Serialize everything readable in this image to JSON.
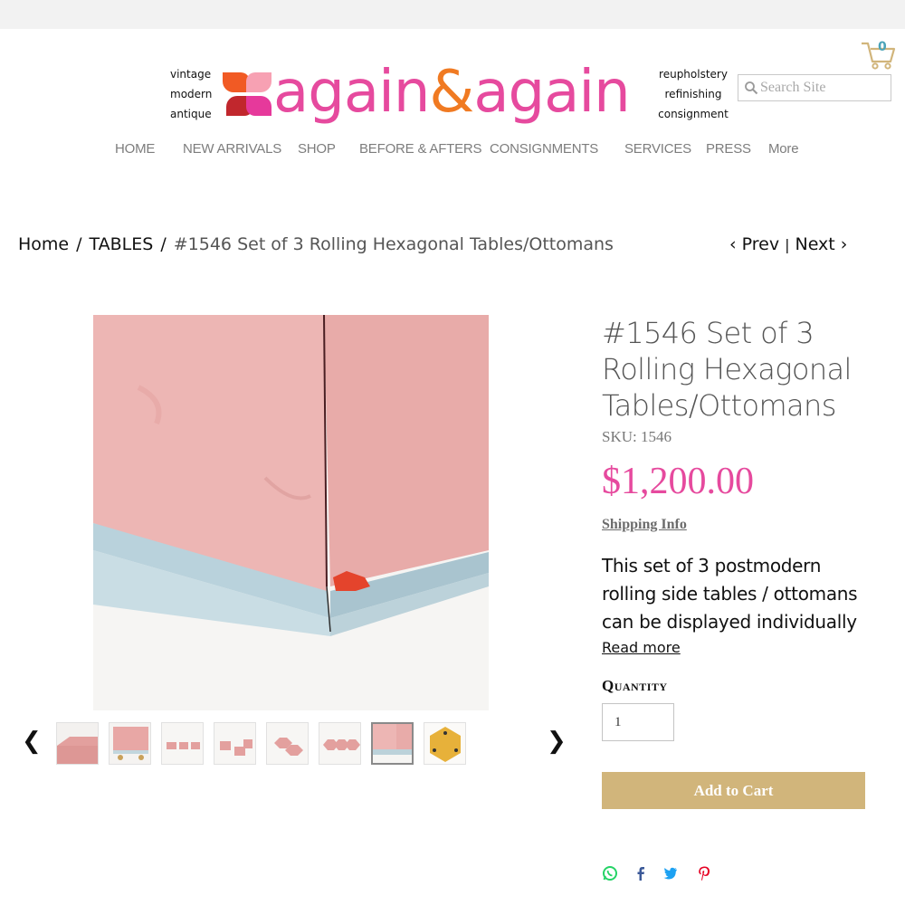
{
  "header": {
    "tagline_left": [
      "vintage",
      "modern",
      "antique"
    ],
    "tagline_right": [
      "reupholstery",
      "refinishing",
      "consignment"
    ],
    "logo": {
      "part1": "again",
      "amp": "&",
      "part2": "again"
    },
    "cart_count": "0",
    "search_placeholder": "Search Site"
  },
  "nav": {
    "items": [
      "HOME",
      "NEW ARRIVALS",
      "SHOP",
      "BEFORE & AFTERS",
      "CONSIGNMENTS",
      "SERVICES",
      "PRESS",
      "More"
    ]
  },
  "breadcrumb": {
    "home": "Home",
    "category": "TABLES",
    "current": "#1546 Set of 3 Rolling Hexagonal Tables/Ottomans",
    "separator": "/"
  },
  "pager": {
    "prev": "Prev",
    "next": "Next",
    "separator": "|"
  },
  "gallery": {
    "prev_arrow": "❮",
    "next_arrow": "❯",
    "thumbnail_count": 8,
    "selected_index": 6
  },
  "product": {
    "title": "#1546 Set of 3 Rolling Hexagonal Tables/Ottomans",
    "sku": "SKU: 1546",
    "price": "$1,200.00",
    "shipping_link": "Shipping Info",
    "description_lines": [
      "This set of 3 postmodern",
      "rolling side tables / ottomans",
      "can be displayed individually"
    ],
    "read_more": "Read more",
    "quantity_label": "Quantity",
    "quantity_value": "1",
    "add_to_cart": "Add to Cart"
  },
  "share": {
    "icons": [
      "whatsapp-icon",
      "facebook-icon",
      "twitter-icon",
      "pinterest-icon"
    ]
  },
  "colors": {
    "brand_pink": "#e64a9e",
    "brand_orange": "#f07a22",
    "button_gold": "#d1b57b",
    "nav_gray": "#7d7d7d"
  }
}
